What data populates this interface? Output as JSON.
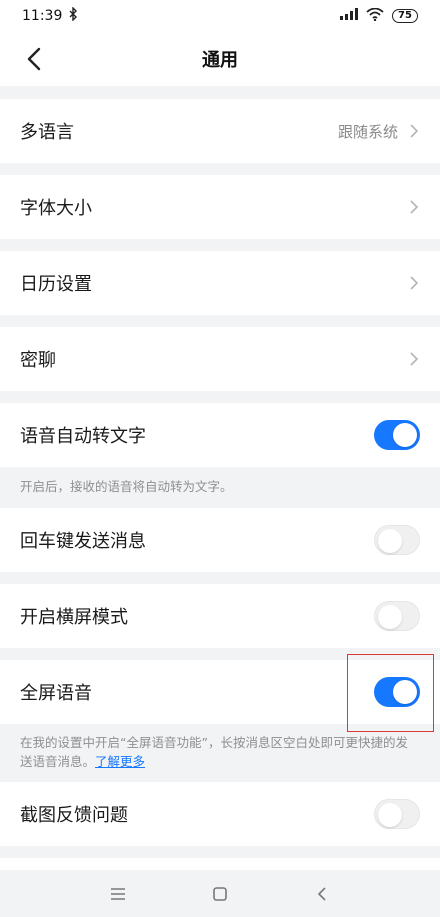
{
  "status": {
    "time": "11:39",
    "battery": "75"
  },
  "header": {
    "title": "通用"
  },
  "rows": {
    "language": {
      "label": "多语言",
      "value": "跟随系统"
    },
    "font_size": {
      "label": "字体大小"
    },
    "calendar": {
      "label": "日历设置"
    },
    "secret_chat": {
      "label": "密聊"
    },
    "voice_to_text": {
      "label": "语音自动转文字",
      "state": "on",
      "hint": "开启后，接收的语音将自动转为文字。"
    },
    "enter_send": {
      "label": "回车键发送消息",
      "state": "off"
    },
    "landscape": {
      "label": "开启横屏模式",
      "state": "off"
    },
    "fullscreen_voice": {
      "label": "全屏语音",
      "state": "on",
      "hint": "在我的设置中开启“全屏语音功能”，长按消息区空白处即可更快捷的发送语音消息。",
      "hint_link": "了解更多"
    },
    "screenshot_feedback": {
      "label": "截图反馈问题",
      "state": "off"
    }
  },
  "colors": {
    "accent": "#1677ff",
    "background": "#f2f3f5",
    "highlight": "#d83a3a"
  },
  "icons": [
    "bluetooth-icon",
    "signal-icon",
    "wifi-icon",
    "battery-icon",
    "back-icon",
    "chevron-right-icon",
    "menu-icon",
    "home-icon",
    "back-nav-icon"
  ]
}
